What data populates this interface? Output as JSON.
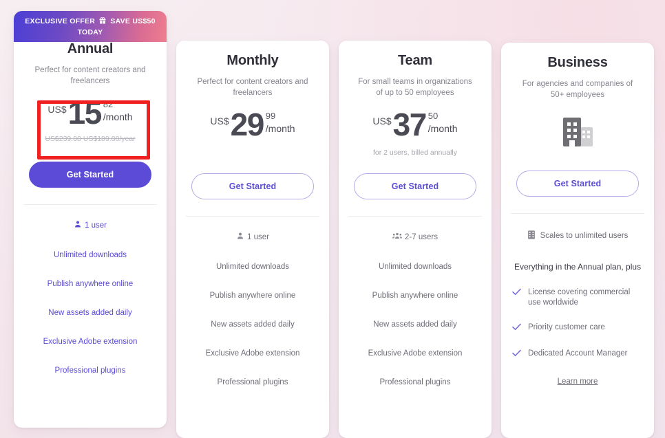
{
  "promo": {
    "text_before": "EXCLUSIVE OFFER",
    "icon": "gift-icon",
    "text_after": "SAVE US$50",
    "text_line2": "TODAY",
    "gradient_from": "#4b3fd6",
    "gradient_to": "#ef7e8e"
  },
  "accent_color": "#5b4bd7",
  "annotation_color": "#f02020",
  "plans": [
    {
      "id": "annual",
      "title": "Annual",
      "description": "Perfect for content creators and freelancers",
      "currency": "US$",
      "price_int": "15",
      "price_cents": "82",
      "period": "/month",
      "strike_text": "US$239.88 US$189.88/year",
      "note": "",
      "cta_label": "Get Started",
      "cta_style": "solid",
      "users_icon": "user-icon",
      "users_label": "1 user",
      "features": [
        "Unlimited downloads",
        "Publish anywhere online",
        "New assets added daily",
        "Exclusive Adobe extension",
        "Professional plugins"
      ]
    },
    {
      "id": "monthly",
      "title": "Monthly",
      "description": "Perfect for content creators and freelancers",
      "currency": "US$",
      "price_int": "29",
      "price_cents": "99",
      "period": "/month",
      "strike_text": "",
      "note": "",
      "cta_label": "Get Started",
      "cta_style": "outline",
      "users_icon": "user-icon",
      "users_label": "1 user",
      "features": [
        "Unlimited downloads",
        "Publish anywhere online",
        "New assets added daily",
        "Exclusive Adobe extension",
        "Professional plugins"
      ]
    },
    {
      "id": "team",
      "title": "Team",
      "description": "For small teams in organizations of up to 50 employees",
      "currency": "US$",
      "price_int": "37",
      "price_cents": "50",
      "period": "/month",
      "strike_text": "",
      "note": "for 2 users, billed annually",
      "cta_label": "Get Started",
      "cta_style": "outline",
      "users_icon": "group-icon",
      "users_label": "2-7 users",
      "features": [
        "Unlimited downloads",
        "Publish anywhere online",
        "New assets added daily",
        "Exclusive Adobe extension",
        "Professional plugins"
      ]
    }
  ],
  "business": {
    "id": "business",
    "title": "Business",
    "description": "For agencies and companies of 50+ employees",
    "icon": "office-building-icon",
    "cta_label": "Get Started",
    "cta_style": "outline",
    "users_icon": "building-icon",
    "users_label": "Scales to unlimited users",
    "heading": "Everything in the Annual plan, plus",
    "features": [
      "License covering commercial use worldwide",
      "Priority customer care",
      "Dedicated Account Manager"
    ],
    "learn_more_label": "Learn more"
  }
}
